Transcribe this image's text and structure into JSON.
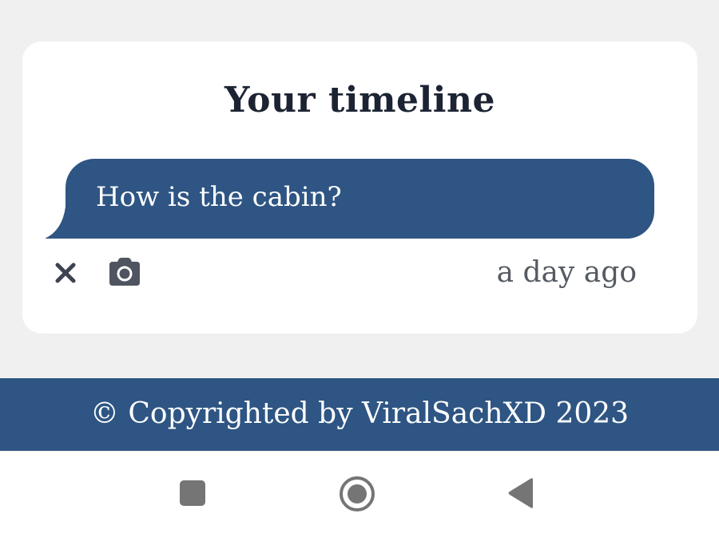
{
  "timeline": {
    "title": "Your timeline",
    "message": {
      "text": "How is the cabin?",
      "timestamp": "a day ago"
    },
    "actions": {
      "close_icon": "close-icon",
      "camera_icon": "camera-icon"
    }
  },
  "footer": {
    "text": "© Copyrighted by ViralSachXD 2023"
  },
  "android_nav": {
    "recents_icon": "square-icon",
    "home_icon": "circle-icon",
    "back_icon": "triangle-back-icon"
  },
  "colors": {
    "accent": "#2e5583",
    "background": "#f0f0f0",
    "card": "#ffffff",
    "title_text": "#1c2433",
    "muted_text": "#555a63"
  }
}
